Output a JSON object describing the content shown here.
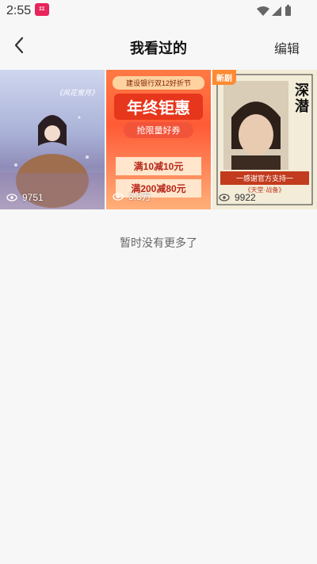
{
  "status_bar": {
    "time": "2:55",
    "app_badge": "ΣΣ",
    "icons": [
      "wifi-icon",
      "signal-icon",
      "battery-icon"
    ]
  },
  "nav": {
    "back_icon": "back-arrow-icon",
    "title": "我看过的",
    "edit_label": "编辑"
  },
  "items": [
    {
      "views": "9751",
      "poster_text": "《风花雪月》",
      "icon": "eye-icon"
    },
    {
      "views": "3.8万",
      "top_banner": "建设银行双12好折节",
      "headline": "年终钜惠",
      "sub": "抢限量好券",
      "offer1": "满10减10元",
      "offer2": "满200减80元",
      "icon": "eye-icon"
    },
    {
      "views": "9922",
      "badge": "新剧",
      "side_title": "深潜",
      "banner": "一感谢官方支持一",
      "subbanner": "《天堂·战备》",
      "icon": "eye-icon"
    }
  ],
  "empty_tip": "暂时没有更多了",
  "colors": {
    "background": "#f7f7f8",
    "accent_orange": "#ff5b36",
    "badge_orange": "#ff8a32"
  }
}
